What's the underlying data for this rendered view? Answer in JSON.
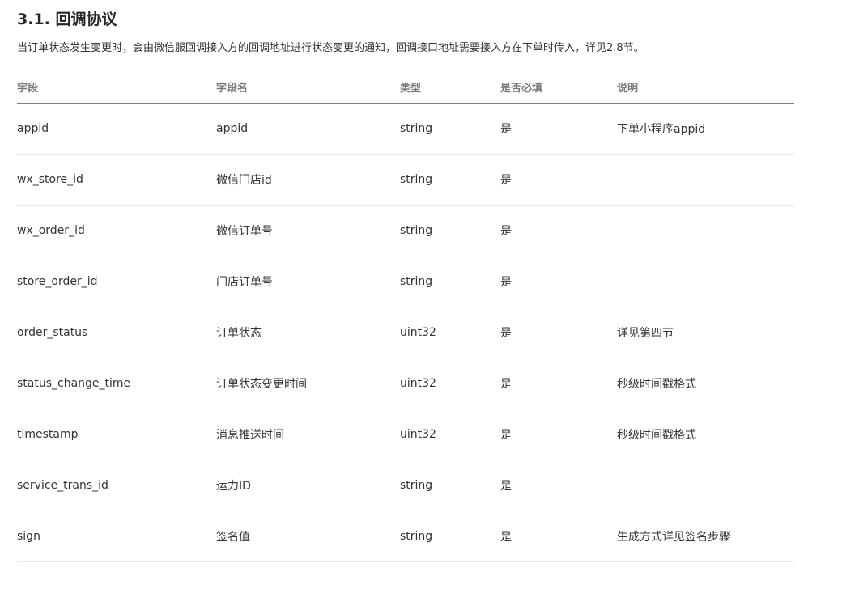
{
  "section": {
    "title": "3.1. 回调协议",
    "description": "当订单状态发生变更时，会由微信服回调接入方的回调地址进行状态变更的通知，回调接口地址需要接入方在下单时传入，详见2.8节。"
  },
  "table": {
    "headers": [
      "字段",
      "字段名",
      "类型",
      "是否必填",
      "说明"
    ],
    "rows": [
      [
        "appid",
        "appid",
        "string",
        "是",
        "下单小程序appid"
      ],
      [
        "wx_store_id",
        "微信门店id",
        "string",
        "是",
        ""
      ],
      [
        "wx_order_id",
        "微信订单号",
        "string",
        "是",
        ""
      ],
      [
        "store_order_id",
        "门店订单号",
        "string",
        "是",
        ""
      ],
      [
        "order_status",
        "订单状态",
        "uint32",
        "是",
        "详见第四节"
      ],
      [
        "status_change_time",
        "订单状态变更时间",
        "uint32",
        "是",
        "秒级时间戳格式"
      ],
      [
        "timestamp",
        "消息推送时间",
        "uint32",
        "是",
        "秒级时间戳格式"
      ],
      [
        "service_trans_id",
        "运力ID",
        "string",
        "是",
        ""
      ],
      [
        "sign",
        "签名值",
        "string",
        "是",
        "生成方式详见签名步骤"
      ]
    ]
  }
}
